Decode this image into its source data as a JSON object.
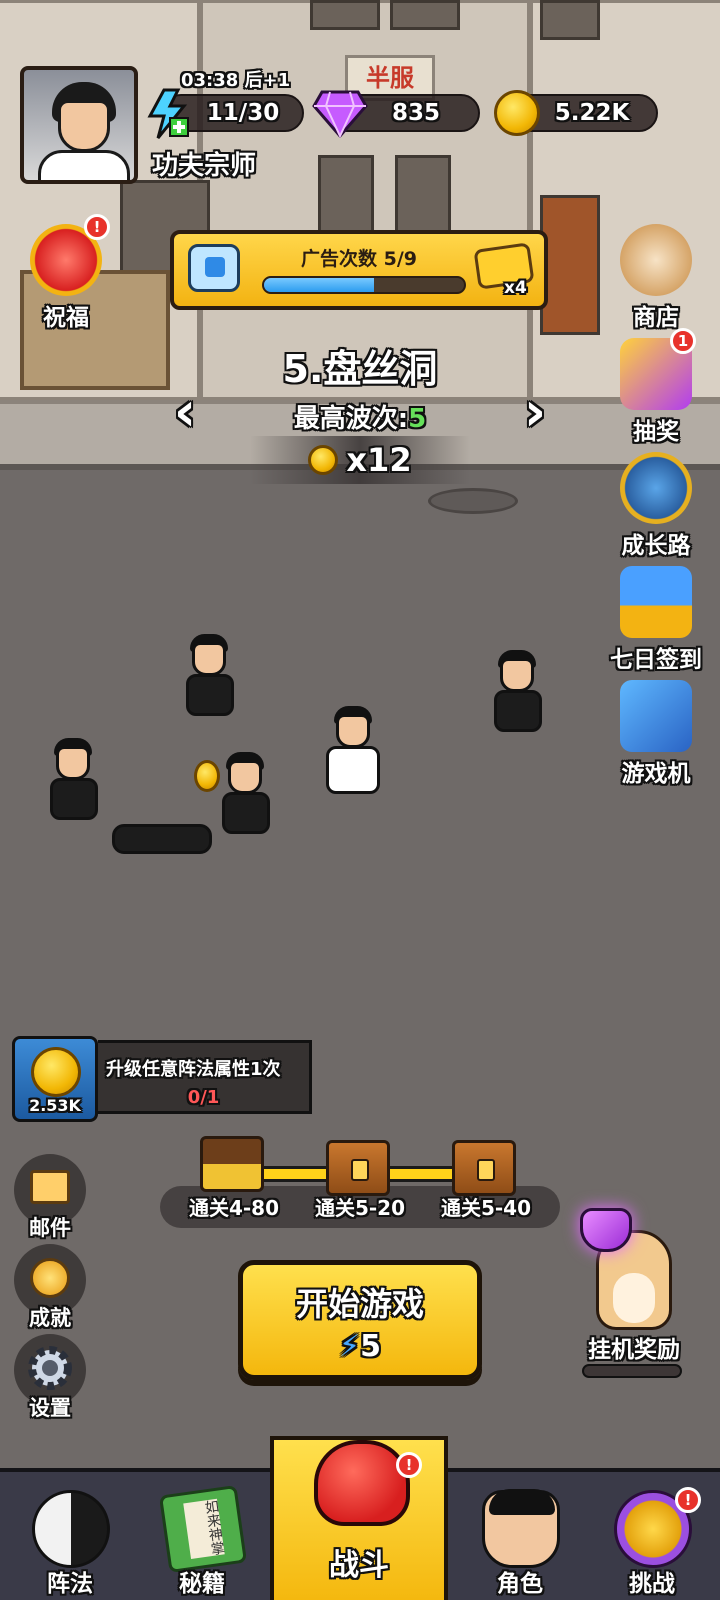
{
  "top_bar": {
    "timer": "03:38 后+1",
    "player_name": "功夫宗师",
    "energy": "11/30",
    "gems": "835",
    "coins": "5.22K"
  },
  "left_side": {
    "blessing_label": "祝福",
    "blessing_badge": "!"
  },
  "ad_bar": {
    "label": "广告次数 5/9",
    "progress": 0.55,
    "multiplier": "x4"
  },
  "stage": {
    "name": "5.盘丝洞",
    "best_wave_label": "最高波次:",
    "best_wave_value": "5",
    "coin_reward": "x12"
  },
  "right_side": {
    "shop_label": "商店",
    "lottery_label": "抽奖",
    "lottery_badge": "1",
    "growth_label": "成长路",
    "signin_label": "七日签到",
    "arcade_label": "游戏机"
  },
  "quest": {
    "amount": "2.53K",
    "text": "升级任意阵法属性1次",
    "progress": "0/1"
  },
  "milestones": [
    {
      "label": "通关4-80"
    },
    {
      "label": "通关5-20"
    },
    {
      "label": "通关5-40"
    }
  ],
  "utility": {
    "mail_label": "邮件",
    "achievement_label": "成就",
    "settings_label": "设置"
  },
  "start_button": {
    "label": "开始游戏",
    "cost": "5"
  },
  "idle_reward": {
    "label": "挂机奖励"
  },
  "bottom_nav": {
    "formation_label": "阵法",
    "manual_label": "秘籍",
    "manual_book_text": "如来神掌",
    "battle_label": "战斗",
    "battle_badge": "!",
    "character_label": "角色",
    "challenge_label": "挑战",
    "challenge_badge": "!"
  },
  "scene": {
    "shop_sign": "半服"
  },
  "colors": {
    "accent_yellow": "#f4b70d",
    "badge_red": "#e8322b",
    "wave_green": "#66e05a",
    "progress_red": "#ff5757"
  }
}
